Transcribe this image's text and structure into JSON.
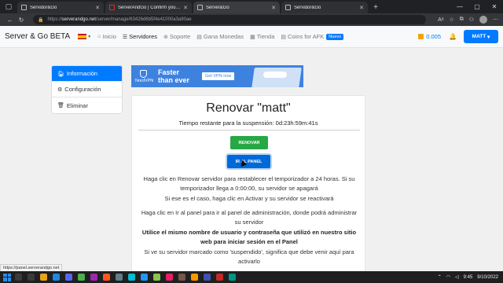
{
  "browser": {
    "tabs": [
      {
        "title": "Servidor&Go",
        "icon": "page-icon",
        "active": false
      },
      {
        "title": "ServerAndGo | Confirm your acc",
        "icon": "gmail-icon",
        "active": false
      },
      {
        "title": "Server&Go",
        "icon": "page-icon",
        "active": true
      },
      {
        "title": "Servidor&Go",
        "icon": "page-icon",
        "active": false
      }
    ],
    "url_scheme": "https://",
    "url_host": "serverandgo.net",
    "url_path": "/server/manage/63426d6b5f4e41000a3a90ae"
  },
  "navbar": {
    "brand": "Server & Go BETA",
    "items": [
      {
        "label": "Inicio",
        "icon": "home-icon",
        "active": false
      },
      {
        "label": "Servidores",
        "icon": "server-icon",
        "active": true
      },
      {
        "label": "Soporte",
        "icon": "lifebuoy-icon",
        "active": false
      },
      {
        "label": "Gana Monedas",
        "icon": "coins-icon",
        "active": false
      },
      {
        "label": "Tienda",
        "icon": "store-icon",
        "active": false
      },
      {
        "label": "Coins for AFK",
        "icon": "coins-icon",
        "active": false
      }
    ],
    "new_badge": "Nuevo",
    "coin_balance": "0.005",
    "user_label": "MATT"
  },
  "sidebar": {
    "items": [
      {
        "label": "Información",
        "icon": "info-icon",
        "active": true
      },
      {
        "label": "Configuración",
        "icon": "gear-icon",
        "active": false
      },
      {
        "label": "Eliminar",
        "icon": "trash-icon",
        "active": false
      }
    ]
  },
  "ad": {
    "logo_text": "NordVPN",
    "headline_1": "Faster",
    "headline_2": "than ever",
    "cta": "Get VPN now"
  },
  "card": {
    "title": "Renovar \"matt\"",
    "remaining_label": "Tiempo restante para la suspensión: 0d:23h:59m:41s",
    "renew_button": "RENOVAR",
    "panel_button": "IR AL PANEL",
    "p1": "Haga clic en Renovar servidor para restablecer el temporizador a 24 horas. Si su temporizador llega a 0:00:00, su servidor se apagará",
    "p2": "Si ese es el caso, haga clic en Activar y su servidor se reactivará",
    "p3": "Haga clic en Ir al panel para ir al panel de administración, donde podrá administrar su servidor",
    "p4": "Utilice el mismo nombre de usuario y contraseña que utilizó en nuestro sitio web para iniciar sesión en el Panel",
    "p5": "Si ve su servidor marcado como 'suspendido', significa que debe venir aquí para activarlo"
  },
  "status_url": "https://panel.serverandgo.net",
  "taskbar": {
    "time": "9:45",
    "date": "9/10/2022"
  },
  "colors": {
    "primary": "#007bff",
    "success": "#28a745",
    "coin": "#f0a500"
  }
}
